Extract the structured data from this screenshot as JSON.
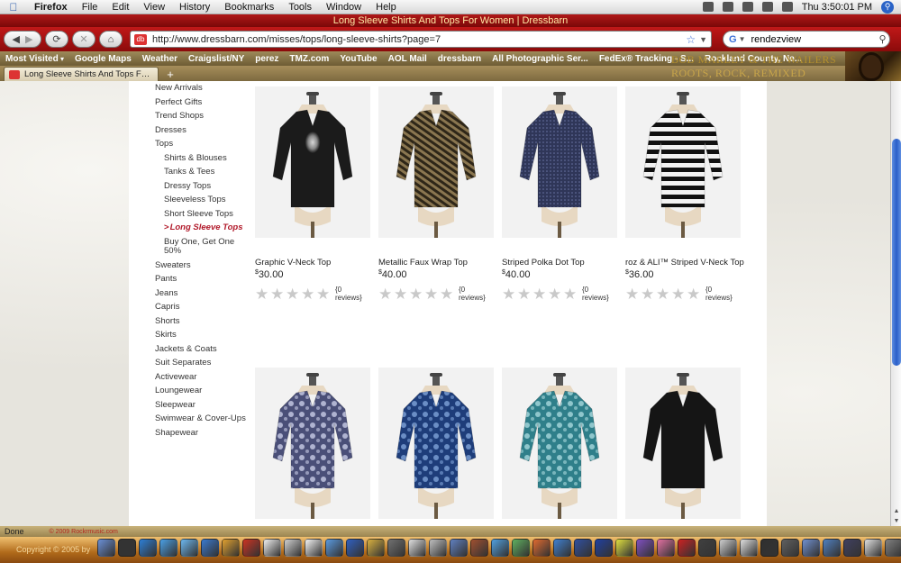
{
  "menubar": {
    "app": "Firefox",
    "items": [
      "File",
      "Edit",
      "View",
      "History",
      "Bookmarks",
      "Tools",
      "Window",
      "Help"
    ],
    "clock": "Thu 3:50:01 PM"
  },
  "window": {
    "title": "Long Sleeve Shirts And Tops For Women | Dressbarn"
  },
  "navbar": {
    "url": "http://www.dressbarn.com/misses/tops/long-sleeve-shirts?page=7",
    "search_value": "rendezview",
    "search_engine_label": "G"
  },
  "bookmarks": {
    "items": [
      "Most Visited",
      "Google Maps",
      "Weather",
      "Craigslist/NY",
      "perez",
      "TMZ.com",
      "YouTube",
      "AOL Mail",
      "dressbarn",
      "All Photographic Ser...",
      "FedEx® Tracking - S...",
      "Rockland County, Ne..."
    ]
  },
  "theme_banner": {
    "line1": "BOB MARLEY & THE WAILERS",
    "line2": "ROOTS, ROCK, REMIXED"
  },
  "tabs": [
    {
      "label": "Long Sleeve Shirts And Tops For ..."
    }
  ],
  "sidebar": {
    "items": [
      {
        "label": "New Arrivals",
        "level": 0
      },
      {
        "label": "Perfect Gifts",
        "level": 0
      },
      {
        "label": "Trend Shops",
        "level": 0
      },
      {
        "label": "Dresses",
        "level": 0
      },
      {
        "label": "Tops",
        "level": 0
      },
      {
        "label": "Shirts & Blouses",
        "level": 1
      },
      {
        "label": "Tanks & Tees",
        "level": 1
      },
      {
        "label": "Dressy Tops",
        "level": 1
      },
      {
        "label": "Sleeveless Tops",
        "level": 1
      },
      {
        "label": "Short Sleeve Tops",
        "level": 1
      },
      {
        "label": "Long Sleeve Tops",
        "level": 1,
        "active": true
      },
      {
        "label": "Buy One, Get One 50%",
        "level": 1
      },
      {
        "label": "Sweaters",
        "level": 0
      },
      {
        "label": "Pants",
        "level": 0
      },
      {
        "label": "Jeans",
        "level": 0
      },
      {
        "label": "Capris",
        "level": 0
      },
      {
        "label": "Shorts",
        "level": 0
      },
      {
        "label": "Skirts",
        "level": 0
      },
      {
        "label": "Jackets & Coats",
        "level": 0
      },
      {
        "label": "Suit Separates",
        "level": 0
      },
      {
        "label": "Activewear",
        "level": 0
      },
      {
        "label": "Loungewear",
        "level": 0
      },
      {
        "label": "Sleepwear",
        "level": 0
      },
      {
        "label": "Swimwear & Cover-Ups",
        "level": 0
      },
      {
        "label": "Shapewear",
        "level": 0
      }
    ]
  },
  "products": [
    {
      "name": "Graphic V-Neck Top",
      "currency": "$",
      "price": "30.00",
      "reviews": "{0 reviews}",
      "rating": 0,
      "colors": [
        "#1b1b1b",
        "#d8d8d8"
      ],
      "pattern": "graphic"
    },
    {
      "name": "Metallic Faux Wrap Top",
      "currency": "$",
      "price": "40.00",
      "reviews": "{0 reviews}",
      "rating": 0,
      "colors": [
        "#8a7650",
        "#2e2618"
      ],
      "pattern": "stripes-diag"
    },
    {
      "name": "Striped Polka Dot Top",
      "currency": "$",
      "price": "40.00",
      "reviews": "{0 reviews}",
      "rating": 0,
      "colors": [
        "#2f3658",
        "#6a74a6"
      ],
      "pattern": "dots"
    },
    {
      "name": "roz & ALI™ Striped V-Neck Top",
      "currency": "$",
      "price": "36.00",
      "reviews": "{0 reviews}",
      "rating": 0,
      "colors": [
        "#111111",
        "#f2f2f2"
      ],
      "pattern": "stripes"
    },
    {
      "name": "",
      "currency": "",
      "price": "",
      "reviews": "",
      "rating": 0,
      "colors": [
        "#4a4f78",
        "#c8cce6"
      ],
      "pattern": "paisley"
    },
    {
      "name": "",
      "currency": "",
      "price": "",
      "reviews": "",
      "rating": 0,
      "colors": [
        "#1e3d7a",
        "#7ea3d8"
      ],
      "pattern": "paisley"
    },
    {
      "name": "",
      "currency": "",
      "price": "",
      "reviews": "",
      "rating": 0,
      "colors": [
        "#2f7f8a",
        "#a8d8dc"
      ],
      "pattern": "floral"
    },
    {
      "name": "",
      "currency": "",
      "price": "",
      "reviews": "",
      "rating": 0,
      "colors": [
        "#151515",
        "#2a2a2a"
      ],
      "pattern": "solid"
    }
  ],
  "statusbar": {
    "text": "Done",
    "credit": "© 2009 Rockrmusic.com"
  },
  "dock": {
    "copyright": "Copyright © 2005 by",
    "icon_colors": [
      "#6a8fd6",
      "#333333",
      "#2d7fd6",
      "#4aa0e6",
      "#6cb8f0",
      "#3a7ad0",
      "#e0a030",
      "#cc3322",
      "#f0f0f0",
      "#d0d0d0",
      "#f5f5f5",
      "#5a9ae0",
      "#3060c0",
      "#d8b040",
      "#707070",
      "#e0e0e0",
      "#c0c0c0",
      "#6080c0",
      "#a05030",
      "#50a0e0",
      "#60b060",
      "#e06a30",
      "#4080d0",
      "#3050a0",
      "#2040a0",
      "#e0e040",
      "#8050c0",
      "#e070a0",
      "#cc2222",
      "#404040",
      "#d0d0d0",
      "#e0e0e0",
      "#303030",
      "#606060",
      "#7090d0",
      "#5080c0",
      "#404060",
      "#e0e0e0",
      "#808080"
    ]
  }
}
